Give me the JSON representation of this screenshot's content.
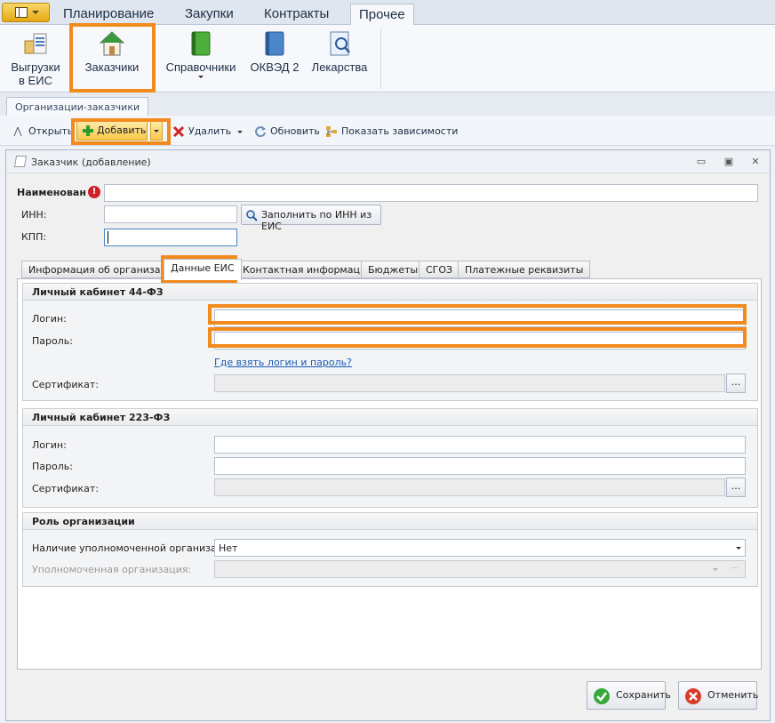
{
  "menu": {
    "tabs": [
      "Планирование",
      "Закупки",
      "Контракты",
      "Прочее"
    ],
    "active_tab": "Прочее"
  },
  "ribbon": {
    "buttons": [
      {
        "label1": "Выгрузки",
        "label2": "в ЕИС",
        "icon": "upload-boxes-icon"
      },
      {
        "label1": "Заказчики",
        "label2": "",
        "icon": "house-icon"
      },
      {
        "label1": "Справочники",
        "label2": "",
        "icon": "green-book-icon"
      },
      {
        "label1": "ОКВЭД 2",
        "label2": "",
        "icon": "blue-book-icon"
      },
      {
        "label1": "Лекарства",
        "label2": "",
        "icon": "notebook-search-icon"
      }
    ]
  },
  "doc_tab": "Организации-заказчики",
  "toolbar": {
    "open": "Открыть",
    "add": "Добавить",
    "delete": "Удалить",
    "refresh": "Обновить",
    "dependencies": "Показать зависимости"
  },
  "dialog": {
    "title": "Заказчик (добавление)",
    "name_label": "Наименован",
    "inn_label": "ИНН:",
    "kpp_label": "КПП:",
    "fill_button": "Заполнить по ИНН из ЕИС",
    "tabs": [
      "Информация об организации",
      "Данные ЕИС",
      "Контактная информация",
      "Бюджеты",
      "СГОЗ",
      "Платежные реквизиты"
    ],
    "active_tab": "Данные ЕИС",
    "group44": {
      "title": "Личный кабинет 44-ФЗ",
      "login": "Логин:",
      "password": "Пароль:",
      "help_link": "Где взять логин и пароль?",
      "certificate": "Сертификат:"
    },
    "group223": {
      "title": "Личный кабинет 223-ФЗ",
      "login": "Логин:",
      "password": "Пароль:",
      "certificate": "Сертификат:"
    },
    "role": {
      "title": "Роль организации",
      "authorized_present_label": "Наличие уполномоченной организации:",
      "authorized_present_value": "Нет",
      "authorized_org_label": "Уполномоченная организация:"
    },
    "save": "Сохранить",
    "cancel": "Отменить"
  },
  "colors": {
    "highlight": "#f28a1e",
    "link": "#1a5bb8",
    "error": "#d0202a"
  }
}
